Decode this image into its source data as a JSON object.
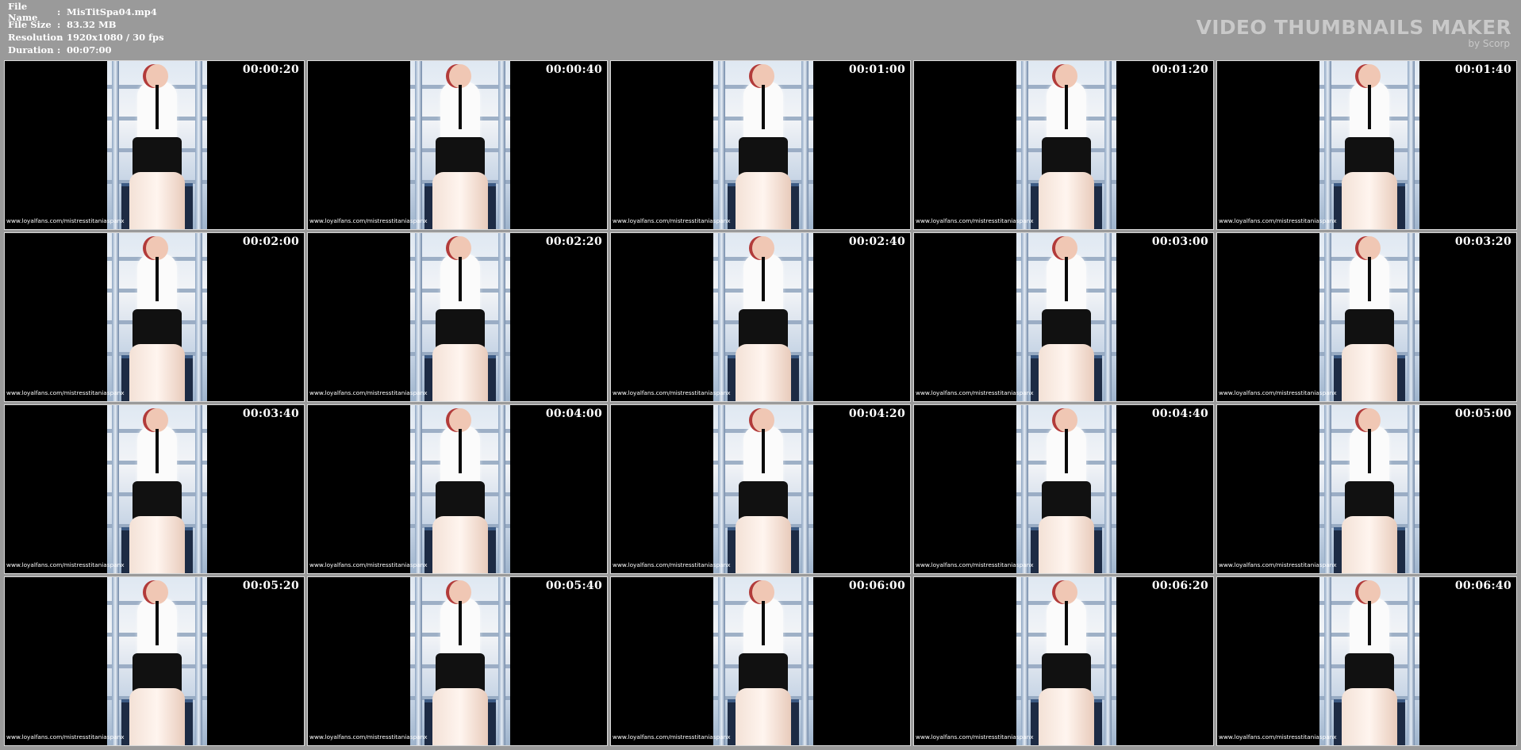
{
  "file_info": [
    {
      "label": "File Name",
      "value": "MisTitSpa04.mp4"
    },
    {
      "label": "File Size",
      "value": "83.32 MB"
    },
    {
      "label": "Resolution",
      "value": "1920x1080 / 30 fps"
    },
    {
      "label": "Duration",
      "value": "00:07:00"
    }
  ],
  "separator": ":",
  "brand": {
    "title": "VIDEO THUMBNAILS MAKER",
    "subtitle": "by Scorp"
  },
  "watermark": "www.loyalfans.com/mistresstitaniaspanx",
  "thumbnails": [
    {
      "time": "00:00:20"
    },
    {
      "time": "00:00:40"
    },
    {
      "time": "00:01:00"
    },
    {
      "time": "00:01:20"
    },
    {
      "time": "00:01:40"
    },
    {
      "time": "00:02:00"
    },
    {
      "time": "00:02:20"
    },
    {
      "time": "00:02:40"
    },
    {
      "time": "00:03:00"
    },
    {
      "time": "00:03:20"
    },
    {
      "time": "00:03:40"
    },
    {
      "time": "00:04:00"
    },
    {
      "time": "00:04:20"
    },
    {
      "time": "00:04:40"
    },
    {
      "time": "00:05:00"
    },
    {
      "time": "00:05:20"
    },
    {
      "time": "00:05:40"
    },
    {
      "time": "00:06:00"
    },
    {
      "time": "00:06:20"
    },
    {
      "time": "00:06:40"
    }
  ],
  "colors": {
    "background": "#9a9a9a",
    "header_text": "#ffffff",
    "brand_text": "#c9c9c9",
    "thumb_bg": "#000000"
  }
}
